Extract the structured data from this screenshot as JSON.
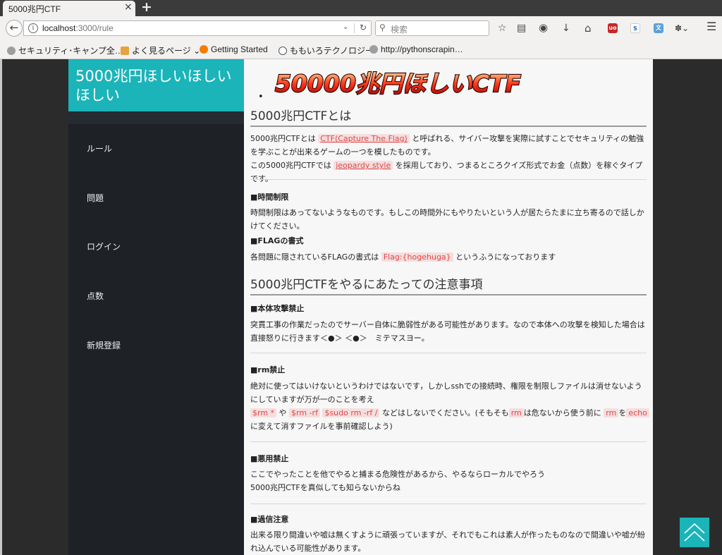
{
  "browser": {
    "tab_title": "5000兆円CTF",
    "tab_close": "×",
    "new_tab": "+",
    "url_host": "localhost",
    "url_rest": ":3000/rule",
    "search_placeholder": "検索"
  },
  "bookmarks": [
    {
      "label": "セキュリティ･キャンプ全…",
      "icon": "globe-icon"
    },
    {
      "label": "よく見るページ",
      "icon": "folder-icon"
    },
    {
      "label": "Getting Started",
      "icon": "firefox-icon"
    },
    {
      "label": "ももいろテクノロジー",
      "icon": "info-icon"
    },
    {
      "label": "http://pythonscrapin…",
      "icon": "globe-icon"
    }
  ],
  "sidebar": {
    "brand": "5000兆円ほしいほしいほしい",
    "items": [
      "ルール",
      "問題",
      "ログイン",
      "点数",
      "新規登録"
    ]
  },
  "main": {
    "logo_text": "50000兆円ほしいCTF",
    "section1_title": "5000兆円CTFとは",
    "intro_a": "5000兆円CTFとは",
    "intro_code1": "CTF(Capture The Flag)",
    "intro_b": "と呼ばれる、サイバー攻撃を実際に試すことでセキュリティの勉強を学ぶことが出来るゲームの一つを模したものです。",
    "intro_c": "この5000兆円CTFでは",
    "intro_code2": "jeopardy style",
    "intro_d": "を採用しており、つまるところクイズ形式でお金（点数）を稼ぐタイプです。",
    "time_title": "■時間制限",
    "time_body": "時間制限はあってないようなものです。もしこの時間外にもやりたいという人が居たらたまに立ち寄るので話しかけてください。",
    "flag_title": "■FLAGの書式",
    "flag_a": "各問題に隠されているFLAGの書式は",
    "flag_code": "Flag:{hogehuga}",
    "flag_b": "というふうになっております",
    "section2_title": "5000兆円CTFをやるにあたっての注意事項",
    "attack_title": "■本体攻撃禁止",
    "attack_body": "突貫工事の作業だったのでサーバー自体に脆弱性がある可能性があります。なので本体への攻撃を検知した場合は直接怒りに行きます＜●＞ ＜●＞　ミテマスヨー。",
    "rm_title": "■rm禁止",
    "rm_body": "絶対に使ってはいけないというわけではないです，しかしsshでの接続時、権限を制限しファイルは消せないようにしていますが万が一のことを考え",
    "rm_code1": "$rm *",
    "rm_t1": "や",
    "rm_code2": "$rm -rf",
    "rm_code3": "$sudo rm -rf /",
    "rm_t2": "などはしないでください。(そもそも",
    "rm_code4": "rm",
    "rm_t3": "は危ないから使う前に",
    "rm_code5": "rm",
    "rm_t4": "を",
    "rm_code6": "echo",
    "rm_t5": "に変えて消すファイルを事前確認しよう)",
    "abuse_title": "■悪用禁止",
    "abuse_body1": "ここでやったことを他でやると捕まる危険性があるから、やるならローカルでやろう",
    "abuse_body2": "5000兆円CTFを真似しても知らないからね",
    "trust_title": "■過信注意",
    "trust_body": "出来る限り間違いや嘘は無くすように頑張っていますが、それでもこれは素人が作ったものなので間違いや嘘が紛れ込んでいる可能性があります。"
  },
  "colors": {
    "brand": "#1bb4b9",
    "sidebar_bg": "#1e2227",
    "code_fg": "#e04848",
    "code_bg": "#f5dede"
  }
}
